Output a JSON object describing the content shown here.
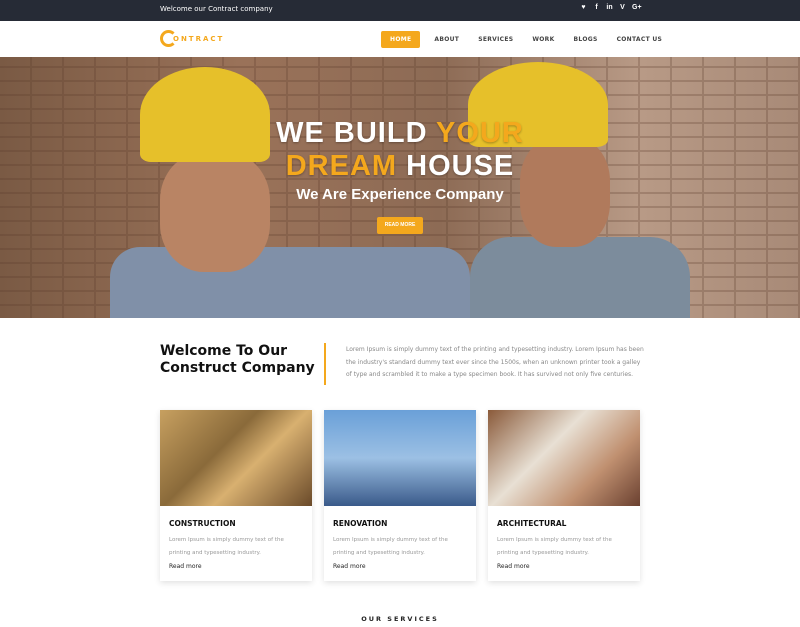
{
  "topbar": {
    "welcome": "Welcome our Contract company",
    "social": [
      {
        "icon": "twitter-icon",
        "glyph": "♥"
      },
      {
        "icon": "facebook-icon",
        "glyph": "f"
      },
      {
        "icon": "linkedin-icon",
        "glyph": "in"
      },
      {
        "icon": "vimeo-icon",
        "glyph": "V"
      },
      {
        "icon": "google-plus-icon",
        "glyph": "G+"
      }
    ]
  },
  "nav": {
    "logo_text": "ONTRACT",
    "items": [
      "HOME",
      "ABOUT",
      "SERVICES",
      "WORK",
      "BLOGS",
      "CONTACT US"
    ],
    "active": "HOME"
  },
  "hero": {
    "line1_white": "WE BUILD ",
    "line1_yellow": "YOUR",
    "line2_yellow": "DREAM ",
    "line2_white": "HOUSE",
    "subtitle": "We Are Experience Company",
    "button": "READ MORE"
  },
  "welcome": {
    "title_line1": "Welcome To Our",
    "title_line2": "Construct Company",
    "text": "Lorem Ipsum is simply dummy text of the printing and typesetting industry. Lorem Ipsum has been the industry's standard dummy text ever since the 1500s, when an unknown printer took a galley of type and scrambled it to make a type specimen book. It has survived not only five centuries."
  },
  "cards": [
    {
      "title": "CONSTRUCTION",
      "desc": "Lorem Ipsum is simply dummy text of the printing and typesetting industry.",
      "link": "Read more"
    },
    {
      "title": "RENOVATION",
      "desc": "Lorem Ipsum is simply dummy text of the printing and typesetting industry.",
      "link": "Read more"
    },
    {
      "title": "ARCHITECTURAL",
      "desc": "Lorem Ipsum is simply dummy text of the printing and typesetting industry.",
      "link": "Read more"
    }
  ],
  "services_label": "OUR SERVICES",
  "colors": {
    "accent": "#f4a81d",
    "topbar": "#262b36"
  }
}
